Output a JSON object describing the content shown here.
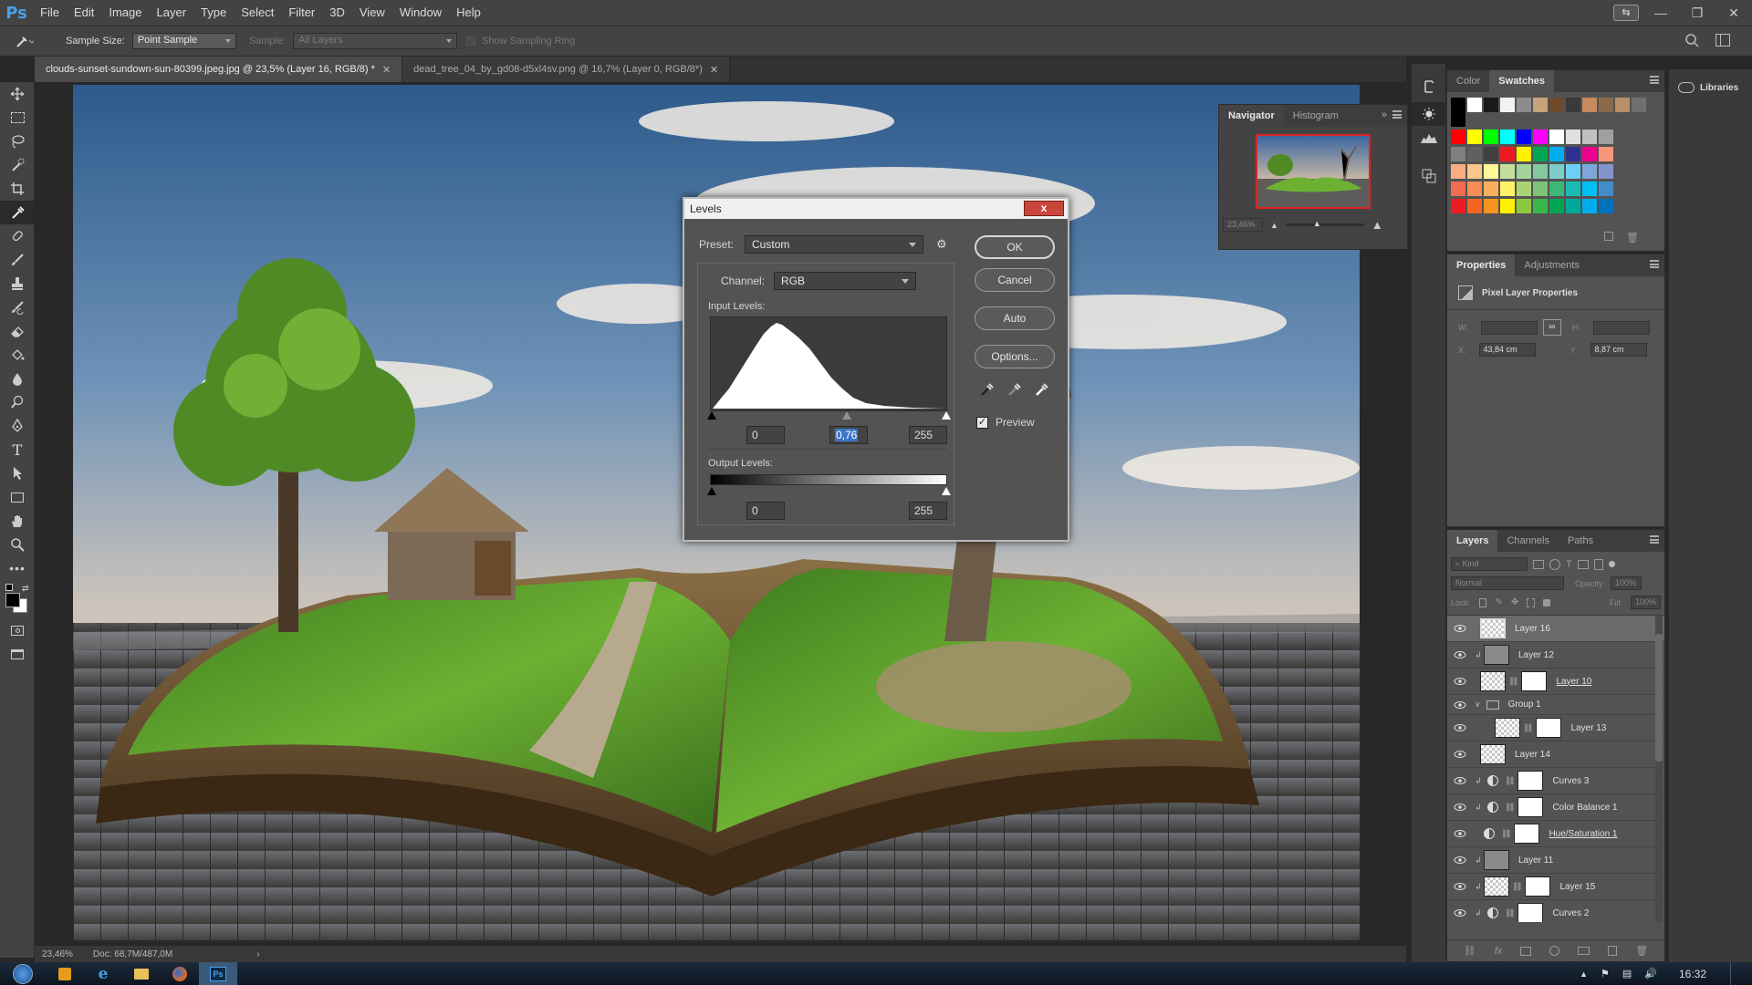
{
  "app": {
    "logo": "Ps"
  },
  "menu": [
    "File",
    "Edit",
    "Image",
    "Layer",
    "Type",
    "Select",
    "Filter",
    "3D",
    "View",
    "Window",
    "Help"
  ],
  "options_bar": {
    "sample_size_label": "Sample Size:",
    "sample_size_value": "Point Sample",
    "sample_label": "Sample:",
    "sample_value": "All Layers",
    "show_ring_label": "Show Sampling Ring"
  },
  "tabs": [
    {
      "label": "clouds-sunset-sundown-sun-80399.jpeg.jpg @ 23,5% (Layer 16, RGB/8) *",
      "active": true
    },
    {
      "label": "dead_tree_04_by_gd08-d5xl4sv.png @ 16,7% (Layer 0, RGB/8*)",
      "active": false
    }
  ],
  "status": {
    "zoom": "23,46%",
    "doc": "Doc: 68,7M/487,0M"
  },
  "navigator": {
    "tabs": [
      "Navigator",
      "Histogram"
    ],
    "zoom": "23,46%"
  },
  "swatches_panel": {
    "tabs": [
      "Color",
      "Swatches"
    ]
  },
  "swatch_colors": {
    "row1": [
      "#000000",
      "#ffffff",
      "#1a1a1a",
      "#f2f2f2",
      "#8c8c8c",
      "#c8a27a",
      "#6e4a2a",
      "#3a3a3a",
      "#c68a5c",
      "#8a6a4a",
      "#b89068",
      "#707070",
      "#000000"
    ],
    "rows": [
      [
        "#ff0000",
        "#ffff00",
        "#00ff00",
        "#00ffff",
        "#0000ff",
        "#ff00ff",
        "#ffffff",
        "#e0e0e0",
        "#c0c0c0",
        "#a0a0a0"
      ],
      [
        "#808080",
        "#606060",
        "#404040",
        "#ed1c24",
        "#fff200",
        "#00a651",
        "#00aeef",
        "#2e3192",
        "#ec008c",
        "#f7977a"
      ],
      [
        "#f9ad81",
        "#fdc68a",
        "#fff79a",
        "#c4df9b",
        "#a3d39c",
        "#82ca9d",
        "#7bcdc8",
        "#6ecff6",
        "#7ea7d8",
        "#8493ca"
      ],
      [
        "#f26c4f",
        "#f68e55",
        "#fbaf5c",
        "#fff467",
        "#acd372",
        "#7cc576",
        "#3bb878",
        "#1abbb4",
        "#00bff3",
        "#438cca"
      ],
      [
        "#ed1c24",
        "#f26522",
        "#f7941d",
        "#fff200",
        "#8dc73f",
        "#39b54a",
        "#00a651",
        "#00a99d",
        "#00aeef",
        "#0072bc"
      ]
    ]
  },
  "properties": {
    "tabs": [
      "Properties",
      "Adjustments"
    ],
    "title": "Pixel Layer Properties",
    "w_label": "W:",
    "h_label": "H:",
    "x_label": "X:",
    "y_label": "Y:",
    "x": "43,84 cm",
    "y": "8,87 cm"
  },
  "libraries_label": "Libraries",
  "layers_panel": {
    "tabs": [
      "Layers",
      "Channels",
      "Paths"
    ],
    "kind_placeholder": "Kind",
    "blend": "Normal",
    "opacity_label": "Opacity:",
    "opacity": "100%",
    "lock_label": "Lock:",
    "fill_label": "Fill:",
    "fill": "100%"
  },
  "layers": [
    {
      "name": "Layer 16",
      "selected": true
    },
    {
      "name": "Layer 12"
    },
    {
      "name": "Layer 10"
    },
    {
      "name": "Group 1"
    },
    {
      "name": "Layer 13"
    },
    {
      "name": "Layer 14"
    },
    {
      "name": "Curves 3"
    },
    {
      "name": "Color Balance 1"
    },
    {
      "name": "Hue/Saturation 1"
    },
    {
      "name": "Layer 11"
    },
    {
      "name": "Layer 15"
    },
    {
      "name": "Curves 2"
    }
  ],
  "levels_dialog": {
    "title": "Levels",
    "preset_label": "Preset:",
    "preset_value": "Custom",
    "channel_label": "Channel:",
    "channel_value": "RGB",
    "input_levels_label": "Input Levels:",
    "input_black": "0",
    "input_gamma": "0,76",
    "input_white": "255",
    "output_levels_label": "Output Levels:",
    "output_black": "0",
    "output_white": "255",
    "ok": "OK",
    "cancel": "Cancel",
    "auto": "Auto",
    "options": "Options...",
    "preview_label": "Preview",
    "preview_checked": true,
    "close": "x"
  },
  "taskbar": {
    "time": "16:32"
  }
}
